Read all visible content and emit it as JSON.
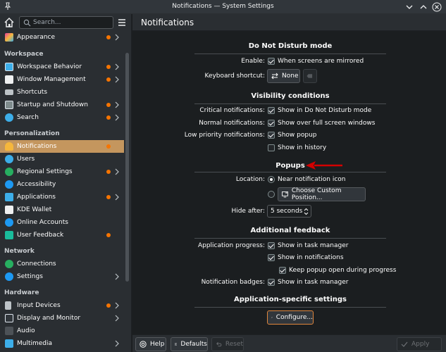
{
  "window": {
    "title": "Notifications — System Settings"
  },
  "sidebar": {
    "search_placeholder": "Search...",
    "appearance_item": {
      "label": "Appearance"
    },
    "categories": {
      "workspace": "Workspace",
      "personalization": "Personalization",
      "network": "Network",
      "hardware": "Hardware"
    },
    "workspace_items": [
      {
        "label": "Workspace Behavior"
      },
      {
        "label": "Window Management"
      },
      {
        "label": "Shortcuts"
      },
      {
        "label": "Startup and Shutdown"
      },
      {
        "label": "Search"
      }
    ],
    "personalization_items": [
      {
        "label": "Notifications"
      },
      {
        "label": "Users"
      },
      {
        "label": "Regional Settings"
      },
      {
        "label": "Accessibility"
      },
      {
        "label": "Applications"
      },
      {
        "label": "KDE Wallet"
      },
      {
        "label": "Online Accounts"
      },
      {
        "label": "User Feedback"
      }
    ],
    "network_items": [
      {
        "label": "Connections"
      },
      {
        "label": "Settings"
      }
    ],
    "hardware_items": [
      {
        "label": "Input Devices"
      },
      {
        "label": "Display and Monitor"
      },
      {
        "label": "Audio"
      },
      {
        "label": "Multimedia"
      }
    ]
  },
  "page": {
    "title": "Notifications",
    "dnd": {
      "heading": "Do Not Disturb mode",
      "enable_label": "Enable:",
      "enable_option": "When screens are mirrored",
      "shortcut_label": "Keyboard shortcut:",
      "shortcut_value": "None"
    },
    "visibility": {
      "heading": "Visibility conditions",
      "critical_label": "Critical notifications:",
      "critical_option": "Show in Do Not Disturb mode",
      "normal_label": "Normal notifications:",
      "normal_option": "Show over full screen windows",
      "low_label": "Low priority notifications:",
      "low_option": "Show popup",
      "history_option": "Show in history"
    },
    "popups": {
      "heading": "Popups",
      "location_label": "Location:",
      "near_icon_option": "Near notification icon",
      "custom_position_button": "Choose Custom Position...",
      "hide_after_label": "Hide after:",
      "hide_after_value": "5 seconds"
    },
    "feedback": {
      "heading": "Additional feedback",
      "progress_label": "Application progress:",
      "task_manager_option": "Show in task manager",
      "notifications_option": "Show in notifications",
      "keep_popup_option": "Keep popup open during progress",
      "badges_label": "Notification badges:",
      "badges_option": "Show in task manager"
    },
    "app_specific": {
      "heading": "Application-specific settings",
      "configure_button": "Configure..."
    }
  },
  "footer": {
    "help": "Help",
    "defaults": "Defaults",
    "reset": "Reset",
    "apply": "Apply"
  },
  "colors": {
    "accent": "#c4965e",
    "notify_dot": "#f67400",
    "annotation_arrow": "#d40000"
  }
}
